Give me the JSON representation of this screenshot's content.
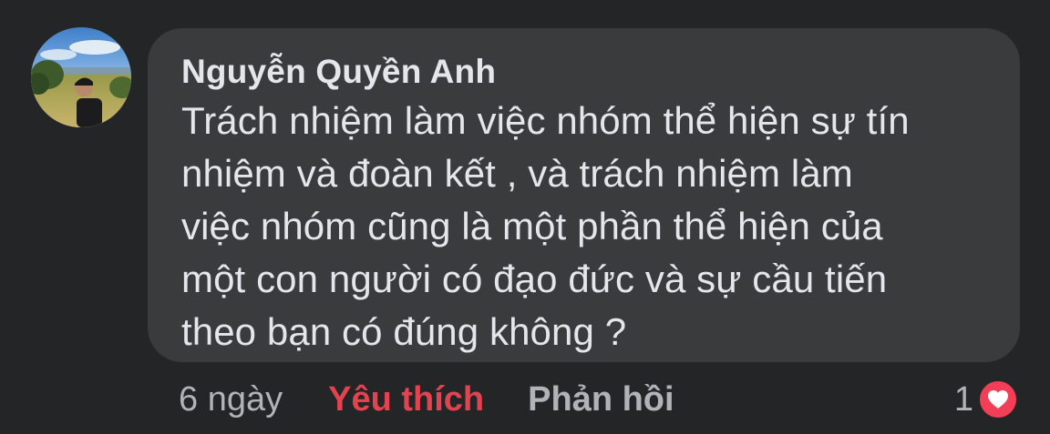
{
  "comment": {
    "author": "Nguyễn Quyền Anh",
    "text": "Trách nhiệm làm việc nhóm thể hiện sự tín\nnhiệm và đoàn kết , và trách nhiệm làm\nviệc nhóm cũng là một phần thể hiện của\nmột con người có đạo đức và sự cầu tiến\ntheo bạn có đúng không ?",
    "timestamp": "6 ngày",
    "like_label": "Yêu thích",
    "reply_label": "Phản hồi",
    "reaction_count": "1",
    "reaction_icon": "heart-icon"
  },
  "colors": {
    "background": "#242526",
    "bubble": "#3a3b3c",
    "text": "#e4e6eb",
    "secondary_text": "#b0b3b8",
    "like_active": "#e3434f",
    "heart": "#f33e58"
  }
}
